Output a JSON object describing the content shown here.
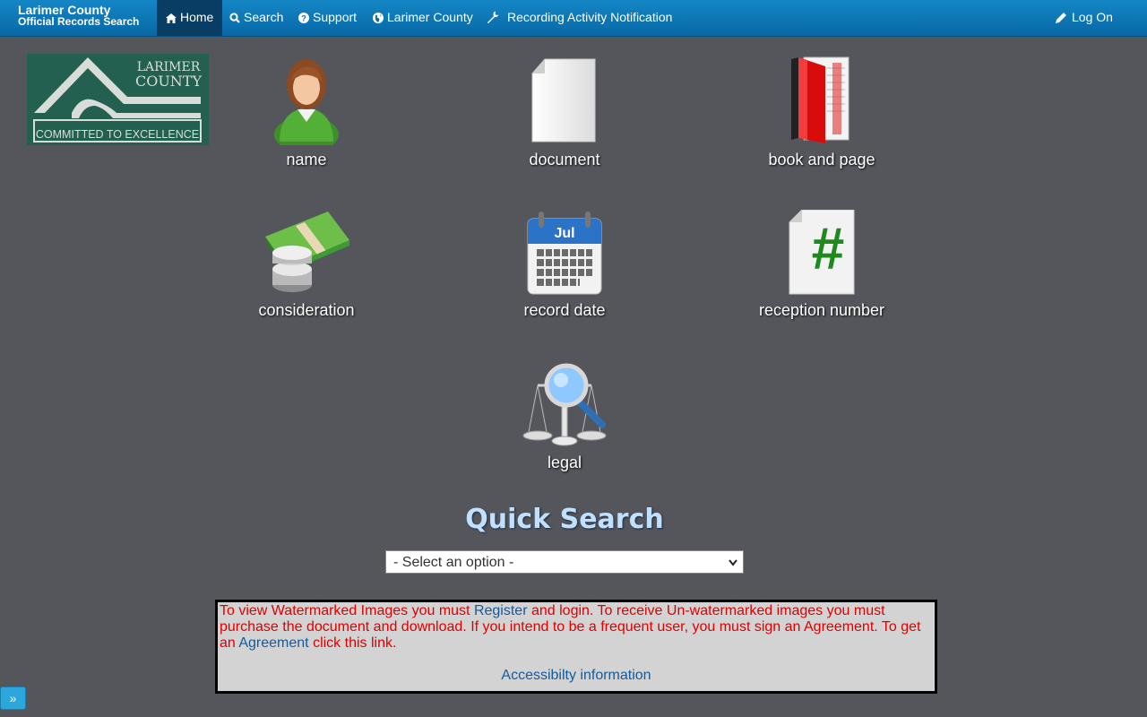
{
  "brand": {
    "line1": "Larimer County",
    "line2": "Official Records Search"
  },
  "nav": [
    {
      "label": "Home",
      "icon": "home-icon",
      "active": true
    },
    {
      "label": "Search",
      "icon": "search-icon"
    },
    {
      "label": "Support",
      "icon": "question-circle-icon"
    },
    {
      "label": "Larimer County",
      "icon": "globe-icon"
    },
    {
      "label": "Recording Activity Notification",
      "icon": "wrench-icon"
    }
  ],
  "login": {
    "label": "Log On",
    "icon": "pencil-icon"
  },
  "logo": {
    "line1": "LARIMER",
    "line2": "COUNTY",
    "tagline": "COMMITTED TO EXCELLENCE"
  },
  "tiles": [
    {
      "label": "name",
      "icon": "person-icon"
    },
    {
      "label": "document",
      "icon": "document-icon"
    },
    {
      "label": "book and page",
      "icon": "book-icon"
    },
    {
      "label": "consideration",
      "icon": "money-icon"
    },
    {
      "label": "record date",
      "icon": "calendar-icon",
      "calendar_month": "Jul"
    },
    {
      "label": "reception number",
      "icon": "hash-document-icon"
    },
    {
      "label": "legal",
      "icon": "scales-magnifier-icon"
    }
  ],
  "quick_search": {
    "title": "Quick Search",
    "select_value": "- Select an option -"
  },
  "notice": {
    "part1": "To view Watermarked Images you must ",
    "register_link": "Register",
    "part2": " and login. To receive Un-watermarked images you must purchase the document and download. If you intend to be a frequent user, you must sign an Agreement. To get an ",
    "agreement_link": "Agreement",
    "part3": " click this link.",
    "accessibility_link": "Accessibilty information"
  },
  "side_toggle": {
    "label": "»"
  },
  "colors": {
    "nav": "#0d78b8",
    "background": "#54565b",
    "notice_text": "#e00000",
    "link": "#145a9c",
    "logo_green": "#23604f"
  }
}
